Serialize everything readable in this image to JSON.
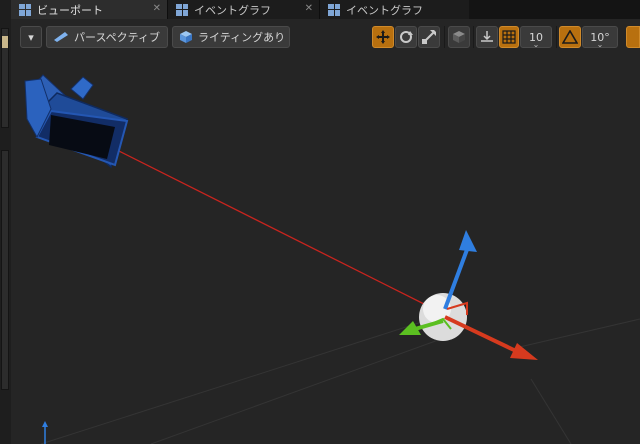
{
  "tabs": [
    {
      "label": "ビューポート",
      "close": "✕"
    },
    {
      "label": "イベントグラフ",
      "close": "✕"
    },
    {
      "label": "イベントグラフ",
      "close": "✕"
    }
  ],
  "toolbar": {
    "menu_arrow": "▾",
    "perspective_label": "パースペクティブ",
    "lighting_label": "ライティングあり",
    "grid_snap_value": "10",
    "rotation_snap_value": "10°"
  },
  "colors": {
    "active_tool": "#b8700f",
    "tab_icon": "#7fa6d6",
    "gizmo_x": "#d63a1e",
    "gizmo_y": "#5bbf21",
    "gizmo_z": "#2f7ee0",
    "camera_body": "#2a5fb7",
    "aim_line": "#c8241e"
  },
  "icons": {
    "tab": "viewport-grid-icon",
    "perspective": "perspective-icon",
    "lighting": "lit-cube-icon",
    "translate": "translate-icon",
    "rotate": "rotate-icon",
    "scale": "scale-icon",
    "world_local": "cube-icon",
    "surface_snap": "surface-snap-icon",
    "grid_snap": "grid-snap-icon",
    "rotation_snap": "angle-snap-icon"
  }
}
